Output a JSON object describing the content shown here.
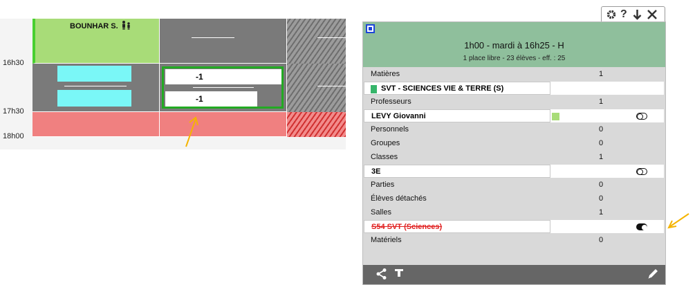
{
  "timetable": {
    "times": [
      "16h30",
      "17h30",
      "18h00"
    ],
    "teacher_label": "BOUNHAR S.",
    "course_values": [
      "-1",
      "-1"
    ]
  },
  "panel": {
    "title": "1h00  -  mardi à 16h25     - H",
    "subtitle": "1 place libre  -  23 élèves  -  eff. : 25",
    "rows": [
      {
        "label": "Matières",
        "count": "1"
      },
      {
        "label": "SVT - SCIENCES VIE & TERRE (S)"
      },
      {
        "label": "Professeurs",
        "count": "1"
      },
      {
        "label": "LEVY Giovanni"
      },
      {
        "label": "Personnels",
        "count": "0"
      },
      {
        "label": "Groupes",
        "count": "0"
      },
      {
        "label": "Classes",
        "count": "1"
      },
      {
        "label": "3E"
      },
      {
        "label": "Parties",
        "count": "0"
      },
      {
        "label": "Élèves détachés",
        "count": "0"
      },
      {
        "label": "Salles",
        "count": "1"
      },
      {
        "label": "S54 SVT (Sciences)"
      },
      {
        "label": "Matériels",
        "count": "0"
      }
    ],
    "tab_icons": [
      "gear-icon",
      "help-icon",
      "arrow-down-icon",
      "close-icon"
    ],
    "footer_icons": [
      "share-icon",
      "text-icon",
      "pencil-icon"
    ]
  },
  "colors": {
    "course_green": "#a8dc78",
    "grey_cell": "#7a7a7a",
    "red_cell": "#f08080",
    "panel_header": "#8fbf9c",
    "room_strike": "#e02020",
    "annotation_arrow": "#f5b400"
  }
}
